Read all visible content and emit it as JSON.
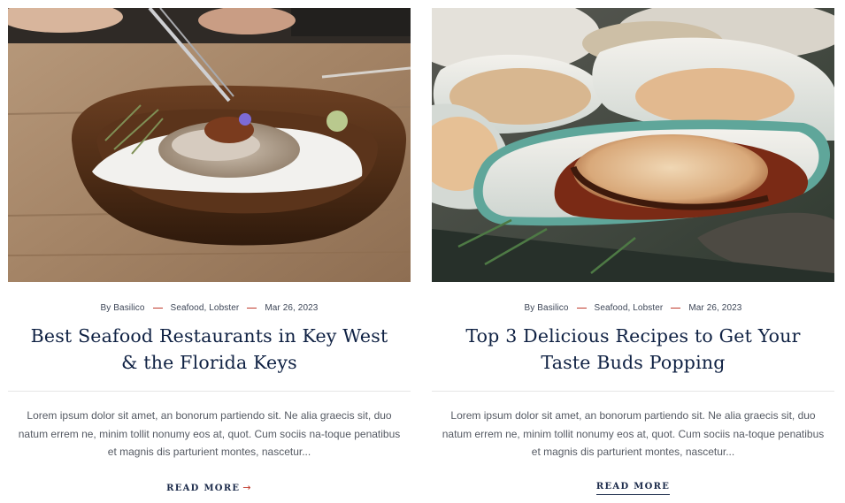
{
  "posts": [
    {
      "image_alt": "Oyster on ice in a wooden bowl",
      "author": "By Basilico",
      "categories": "Seafood, Lobster",
      "date": "Mar 26, 2023",
      "title": "Best Seafood Restaurants in Key West & the Florida Keys",
      "excerpt": "Lorem ipsum dolor sit amet, an bonorum partiendo sit. Ne alia graecis sit, duo natum errem ne, minim tollit nonumy eos at, quot. Cum sociis na-toque penatibus et magnis dis parturient montes, nascetur...",
      "read_more": "READ MORE",
      "read_more_arrow": "→"
    },
    {
      "image_alt": "Mussels in shells with sauce",
      "author": "By Basilico",
      "categories": "Seafood, Lobster",
      "date": "Mar 26, 2023",
      "title": "Top 3 Delicious Recipes to Get Your Taste Buds Popping",
      "excerpt": "Lorem ipsum dolor sit amet, an bonorum partiendo sit. Ne alia graecis sit, duo natum errem ne, minim tollit nonumy eos at, quot. Cum sociis na-toque penatibus et magnis dis parturient montes, nascetur...",
      "read_more": "READ MORE",
      "read_more_arrow": ""
    }
  ],
  "colors": {
    "accent": "#c0392b",
    "title": "#0f2143",
    "text": "#555a63"
  }
}
